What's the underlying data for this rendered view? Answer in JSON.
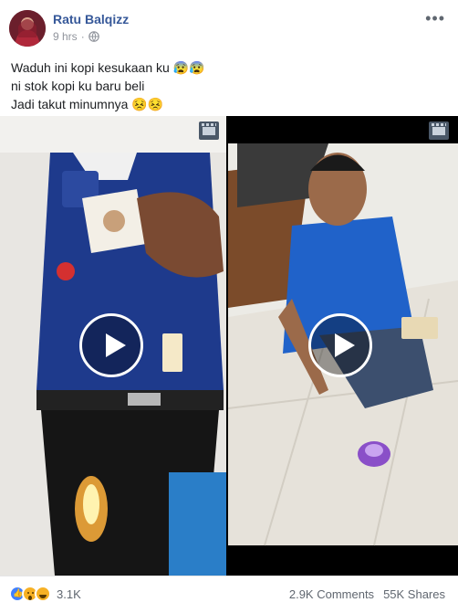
{
  "post": {
    "author": "Ratu Balqizz",
    "time": "9 hrs",
    "separator": "·",
    "privacy_icon": "globe-icon",
    "more_icon": "•••",
    "text_lines": [
      "Waduh ini kopi kesukaan ku 😰😰",
      "ni stok kopi ku baru beli",
      "Jadi takut minumnya 😣😣"
    ]
  },
  "videos": [
    {
      "name": "video-left",
      "icon": "play-icon",
      "badge_icon": "clip-icon"
    },
    {
      "name": "video-right",
      "icon": "play-icon",
      "badge_icon": "clip-icon"
    }
  ],
  "footer": {
    "reactions": [
      "like",
      "wow",
      "haha"
    ],
    "reaction_count": "3.1K",
    "comments": "2.9K Comments",
    "shares": "55K Shares"
  },
  "colors": {
    "author_link": "#365899",
    "meta_text": "#90949c",
    "like_blue": "#4080ff",
    "reaction_yellow": "#f7b125"
  }
}
